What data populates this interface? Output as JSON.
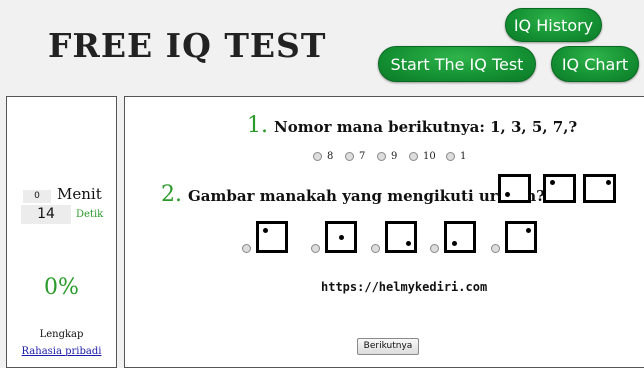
{
  "header": {
    "logo": "FREE IQ TEST",
    "btn_history": "IQ History",
    "btn_start": "Start The IQ Test",
    "btn_chart": "IQ Chart"
  },
  "sidebar": {
    "minutes_value": "0",
    "minutes_label": "Menit",
    "seconds_value": "14",
    "seconds_label": "Detik",
    "progress": "0%",
    "complete_label": "Lengkap",
    "privacy_link": "Rahasia pribadi"
  },
  "questions": [
    {
      "number": "1.",
      "text": "Nomor mana berikutnya: 1, 3, 5, 7,?",
      "options": [
        "8",
        "7",
        "9",
        "10",
        "1"
      ]
    },
    {
      "number": "2.",
      "text": "Gambar manakah yang mengikuti urutan?",
      "pattern_icons": [
        "square-dot-bottom-left-icon",
        "square-dot-top-left-icon",
        "square-dot-top-right-icon"
      ],
      "option_icons": [
        "square-dot-top-left-icon",
        "square-dot-center-icon",
        "square-dot-bottom-right-icon",
        "square-dot-bottom-left-icon",
        "square-dot-top-right-icon"
      ]
    }
  ],
  "watermark": "https://helmykediri.com",
  "next_button": "Berikutnya"
}
